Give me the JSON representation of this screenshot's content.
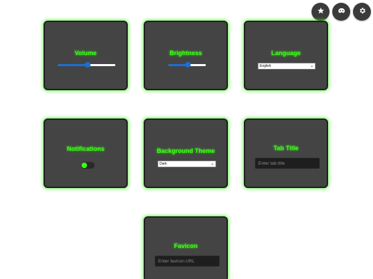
{
  "toolbar": {
    "buttons": [
      {
        "icon": "star-icon"
      },
      {
        "icon": "mask-icon"
      },
      {
        "icon": "gear-icon"
      }
    ]
  },
  "settings": {
    "volume": {
      "title": "Volume",
      "value_fraction": 0.52
    },
    "brightness": {
      "title": "Brightness",
      "value_fraction": 0.52
    },
    "language": {
      "title": "Language",
      "selected": "English"
    },
    "notifications": {
      "title": "Notifications",
      "enabled": true
    },
    "background_theme": {
      "title": "Background Theme",
      "selected": "Dark"
    },
    "tab_title": {
      "title": "Tab Title",
      "placeholder": "Enter tab title",
      "value": ""
    },
    "favicon": {
      "title": "Favicon",
      "placeholder": "Enter favicon URL",
      "value": ""
    }
  },
  "colors": {
    "accent_glow": "#39ff14",
    "card_background": "#444444",
    "slider_fill": "#1a6fd6",
    "input_background": "#1e1e1e"
  }
}
